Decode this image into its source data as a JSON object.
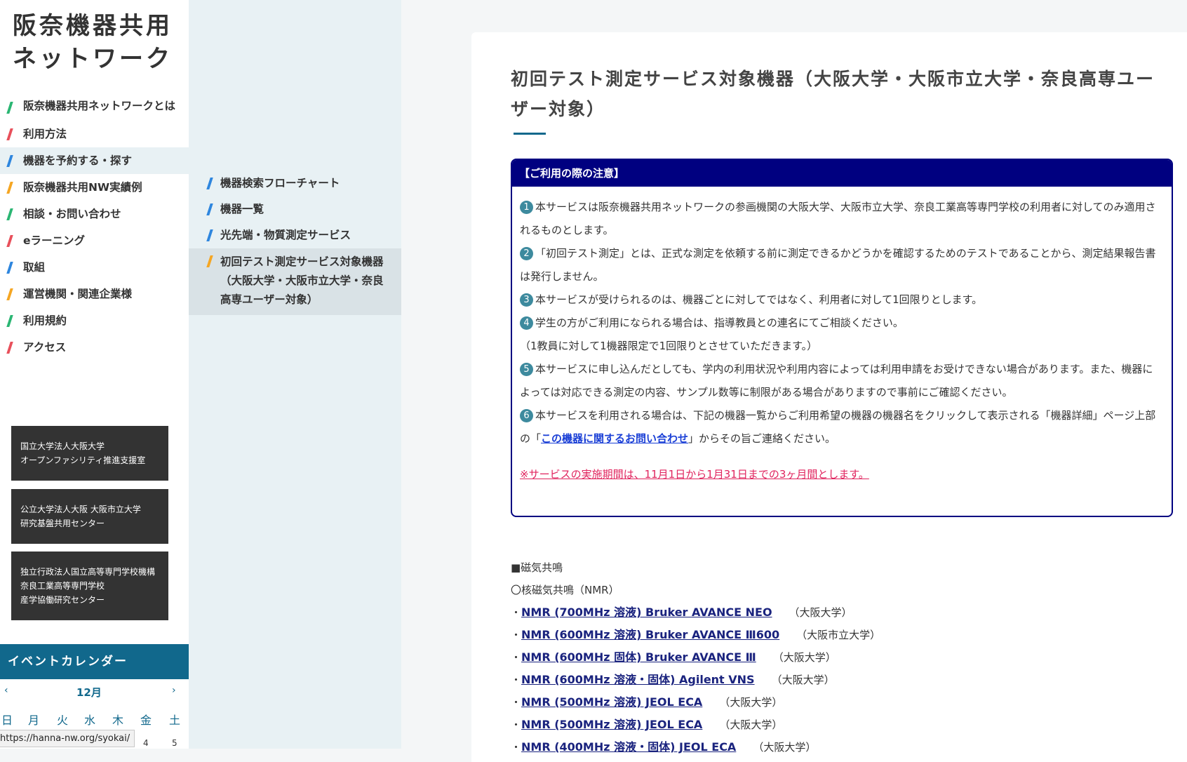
{
  "site": {
    "title_line1": "阪奈機器共用",
    "title_line2": "ネットワーク"
  },
  "nav": [
    {
      "label": "阪奈機器共用ネットワークとは",
      "color": "#2bb673"
    },
    {
      "label": "利用方法",
      "color": "#e8505b"
    },
    {
      "label": "機器を予約する・探す",
      "color": "#2e86de",
      "active": true
    },
    {
      "label": "阪奈機器共用NW実績例",
      "color": "#f5a623"
    },
    {
      "label": "相談・お問い合わせ",
      "color": "#2bb673"
    },
    {
      "label": "eラーニング",
      "color": "#e8505b"
    },
    {
      "label": "取組",
      "color": "#2e86de"
    },
    {
      "label": "運営機関・関連企業様",
      "color": "#f5a623"
    },
    {
      "label": "利用規約",
      "color": "#2bb673"
    },
    {
      "label": "アクセス",
      "color": "#e8505b"
    }
  ],
  "org_links": [
    {
      "lines": [
        "国立大学法人大阪大学",
        "オープンファシリティ推進支援室"
      ]
    },
    {
      "lines": [
        "公立大学法人大阪 大阪市立大学",
        "研究基盤共用センター"
      ]
    },
    {
      "lines": [
        "独立行政法人国立高等専門学校機構",
        "奈良工業高等専門学校",
        "産学協働研究センター"
      ]
    }
  ],
  "calendar": {
    "title": "イベントカレンダー",
    "month": "12月",
    "prev": "‹",
    "next": "›",
    "weekdays": [
      "日",
      "月",
      "火",
      "水",
      "木",
      "金",
      "土"
    ],
    "visible_days": [
      "4",
      "5"
    ]
  },
  "status_url": "https://hanna-nw.org/syokai/",
  "submenu": [
    {
      "label": "機器検索フローチャート",
      "color": "#2e86de"
    },
    {
      "label": "機器一覧",
      "color": "#2e86de"
    },
    {
      "label": "光先端・物質測定サービス",
      "color": "#2e86de"
    },
    {
      "label": "初回テスト測定サービス対象機器（大阪大学・大阪市立大学・奈良高専ユーザー対象）",
      "color": "#f5a623",
      "active": true
    }
  ],
  "main": {
    "title": "初回テスト測定サービス対象機器（大阪大学・大阪市立大学・奈良高専ユーザー対象）",
    "notice": {
      "heading": "【ご利用の際の注意】",
      "items": [
        {
          "num": "1",
          "text": "本サービスは阪奈機器共用ネットワークの参画機関の大阪大学、大阪市立大学、奈良工業高等専門学校の利用者に対してのみ適用されるものとします。"
        },
        {
          "num": "2",
          "text": "「初回テスト測定」とは、正式な測定を依頼する前に測定できるかどうかを確認するためのテストであることから、測定結果報告書は発行しません。"
        },
        {
          "num": "3",
          "text": "本サービスが受けられるのは、機器ごとに対してではなく、利用者に対して1回限りとします。"
        },
        {
          "num": "4",
          "text": "学生の方がご利用になられる場合は、指導教員との連名にてご相談ください。"
        },
        {
          "num": "",
          "text": "（1教員に対して1機器限定で1回限りとさせていただきます。）"
        },
        {
          "num": "5",
          "text": "本サービスに申し込んだとしても、学内の利用状況や利用内容によっては利用申請をお受けできない場合があります。また、機器によっては対応できる測定の内容、サンプル数等に制限がある場合がありますので事前にご確認ください。"
        },
        {
          "num": "6",
          "text_before": "本サービスを利用される場合は、下記の機器一覧からご利用希望の機器の機器名をクリックして表示される「機器詳細」ページ上部の「",
          "link": "この機器に関するお問い合わせ",
          "text_after": "」からその旨ご連絡ください。"
        }
      ],
      "period": "※サービスの実施期間は、11月1日から1月31日までの3ヶ月間とします。"
    },
    "section_heading": "■磁気共鳴",
    "subsection_heading": "〇核磁気共鳴（NMR）",
    "bullet": "・",
    "instruments": [
      {
        "name": "NMR (700MHz 溶液) Bruker AVANCE NEO",
        "place": "（大阪大学）"
      },
      {
        "name": "NMR (600MHz 溶液) Bruker AVANCE Ⅲ600",
        "place": "（大阪市立大学）"
      },
      {
        "name": "NMR (600MHz 固体) Bruker AVANCE Ⅲ",
        "place": "（大阪大学）"
      },
      {
        "name": "NMR (600MHz 溶液・固体) Agilent VNS",
        "place": "（大阪大学）"
      },
      {
        "name": "NMR (500MHz 溶液) JEOL ECA",
        "place": "（大阪大学）"
      },
      {
        "name": "NMR (500MHz 溶液) JEOL ECA",
        "place": "（大阪大学）"
      },
      {
        "name": "NMR (400MHz 溶液・固体) JEOL ECA",
        "place": "（大阪大学）"
      }
    ]
  }
}
